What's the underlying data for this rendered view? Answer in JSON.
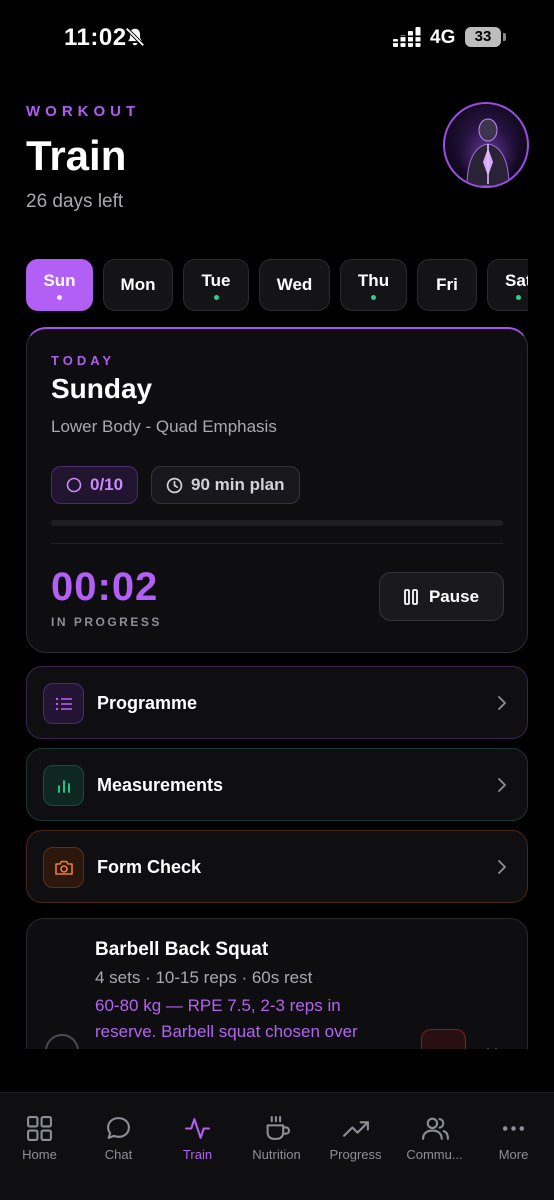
{
  "status_bar": {
    "time": "11:02",
    "network": "4G",
    "battery": "33"
  },
  "header": {
    "eyebrow": "WORKOUT",
    "title": "Train",
    "subtitle": "26 days left"
  },
  "days": [
    {
      "label": "Sun",
      "active": true,
      "dot": true
    },
    {
      "label": "Mon",
      "active": false,
      "dot": false
    },
    {
      "label": "Tue",
      "active": false,
      "dot": true
    },
    {
      "label": "Wed",
      "active": false,
      "dot": false
    },
    {
      "label": "Thu",
      "active": false,
      "dot": true
    },
    {
      "label": "Fri",
      "active": false,
      "dot": false
    },
    {
      "label": "Sat",
      "active": false,
      "dot": true
    }
  ],
  "today": {
    "kicker": "TODAY",
    "day": "Sunday",
    "focus": "Lower Body - Quad Emphasis",
    "completed_label": "0/10",
    "plan_label": "90 min plan",
    "progress": 0,
    "timer": "00:02",
    "timer_status": "IN PROGRESS",
    "pause_label": "Pause"
  },
  "menu": {
    "programme": "Programme",
    "measurements": "Measurements",
    "form_check": "Form Check"
  },
  "exercise": {
    "name": "Barbell Back Squat",
    "meta": "4 sets  ·  10-15 reps  ·  60s rest",
    "note": "60-80 kg — RPE 7.5, 2-3 reps in reserve. Barbell squat chosen over Smith machine because free weight"
  },
  "nav": {
    "home": "Home",
    "chat": "Chat",
    "train": "Train",
    "nutrition": "Nutrition",
    "progress": "Progress",
    "community": "Commu...",
    "more": "More"
  },
  "colors": {
    "accent": "#b25ff5",
    "dot_green": "#2ecf8b",
    "background": "#000000"
  }
}
